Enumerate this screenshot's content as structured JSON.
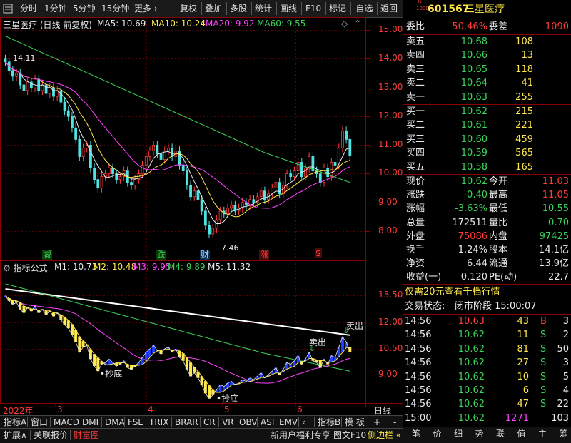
{
  "toolbar": {
    "left": [
      "分时",
      "1分钟",
      "5分钟",
      "15分钟",
      "更多 ›"
    ],
    "right": [
      "复权",
      "叠加",
      "多股",
      "统计",
      "画线",
      "F10",
      "标记",
      "-自选",
      "返回"
    ]
  },
  "chart": {
    "title": "三星医疗 (日线 前复权)",
    "ma": [
      {
        "label": "MA5: 10.69",
        "color": "#e8e8e8"
      },
      {
        "label": "MA10: 10.24",
        "color": "#ffe84a"
      },
      {
        "label": "MA20: 9.92",
        "color": "#ff44ff"
      },
      {
        "label": "MA60: 9.55",
        "color": "#3cd35a"
      }
    ],
    "price_axis": [
      "15.00",
      "14.00",
      "13.00",
      "12.00",
      "11.00",
      "10.00",
      "9.00",
      "8.00"
    ],
    "high_note": "14.11",
    "low_note": "7.46",
    "markers": [
      {
        "text": "减",
        "color": "#3cd35a"
      },
      {
        "text": "跌",
        "color": "#3cd35a"
      },
      {
        "text": "财",
        "color": "#4fa0ff"
      },
      {
        "text": "涨",
        "color": "#ff3b3b"
      },
      {
        "text": "$",
        "color": "#ff3b3b"
      }
    ],
    "indicator_title": "指标公式",
    "indicator_lines": [
      {
        "label": "M1: 10.73",
        "color": "#e8e8e8"
      },
      {
        "label": "M2: 10.48",
        "color": "#ffe84a"
      },
      {
        "label": "M3: 9.95",
        "color": "#ff44ff"
      },
      {
        "label": "M4: 9.89",
        "color": "#3cd35a"
      },
      {
        "label": "M5: 11.32",
        "color": "#e8e8e8"
      }
    ],
    "indicator_axis": [
      "13.50",
      "12.00",
      "10.50",
      "9.00"
    ],
    "annotations": {
      "buy1": "•抄底",
      "buy2": "•抄底",
      "sell1": "卖出",
      "sell2": "卖出"
    },
    "x_axis": [
      "2022年",
      "3",
      "4",
      "5",
      "6"
    ],
    "x_axis_right": "日线"
  },
  "tabs_row1": [
    "指标A",
    "窗口",
    "MACD",
    "DMI",
    "DMA",
    "FSL",
    "TRIX",
    "BRAR",
    "CR",
    "VR",
    "OBV",
    "ASI",
    "EMV",
    "‹",
    "指标B",
    "模 板",
    "+",
    "-"
  ],
  "tabs_row2": {
    "left": [
      "扩展∧",
      "关联报价",
      "财富圈"
    ],
    "right": [
      "新用户福利专享",
      "图文F10",
      "侧边栏 «"
    ]
  },
  "panel": {
    "code": "601567",
    "name": "三星医疗",
    "badge": "R",
    "wei_bi_label": "委比",
    "wei_bi": "50.46%",
    "wei_cha_label": "委差",
    "wei_cha": "1090",
    "asks": [
      {
        "label": "卖五",
        "price": "10.68",
        "vol": "108"
      },
      {
        "label": "卖四",
        "price": "10.66",
        "vol": "13"
      },
      {
        "label": "卖三",
        "price": "10.65",
        "vol": "118"
      },
      {
        "label": "卖二",
        "price": "10.64",
        "vol": "41"
      },
      {
        "label": "卖一",
        "price": "10.63",
        "vol": "255"
      }
    ],
    "bids": [
      {
        "label": "买一",
        "price": "10.62",
        "vol": "215"
      },
      {
        "label": "买二",
        "price": "10.61",
        "vol": "221"
      },
      {
        "label": "买三",
        "price": "10.60",
        "vol": "459"
      },
      {
        "label": "买四",
        "price": "10.59",
        "vol": "565"
      },
      {
        "label": "买五",
        "price": "10.58",
        "vol": "165"
      }
    ],
    "stats": [
      {
        "l1": "现价",
        "v1": "10.62",
        "c1": "green",
        "l2": "今开",
        "v2": "11.03",
        "c2": "red"
      },
      {
        "l1": "涨跌",
        "v1": "-0.40",
        "c1": "green",
        "l2": "最高",
        "v2": "11.05",
        "c2": "red"
      },
      {
        "l1": "涨幅",
        "v1": "-3.63%",
        "c1": "green",
        "l2": "最低",
        "v2": "10.55",
        "c2": "green"
      },
      {
        "l1": "总量",
        "v1": "172511",
        "c1": "white",
        "l2": "量比",
        "v2": "0.70",
        "c2": "green"
      },
      {
        "l1": "外盘",
        "v1": "75086",
        "c1": "red",
        "l2": "内盘",
        "v2": "97425",
        "c2": "green"
      }
    ],
    "stats2": [
      {
        "l1": "换手",
        "v1": "1.24%",
        "l2": "股本",
        "v2": "14.1亿"
      },
      {
        "l1": "净资",
        "v1": "6.44",
        "l2": "流通",
        "v2": "13.9亿"
      },
      {
        "l1": "收益(一)",
        "v1": "0.120",
        "l2": "PE(动)",
        "v2": "22.7"
      }
    ],
    "promo": "仅需20元查看千档行情",
    "trade_status_label": "交易状态:",
    "trade_status": "闭市阶段 15:00:07",
    "ticks": [
      {
        "time": "14:56",
        "price": "10.63",
        "pc": "red",
        "vol": "43",
        "side": "B",
        "sc": "red",
        "n": "3"
      },
      {
        "time": "14:56",
        "price": "10.62",
        "pc": "green",
        "vol": "11",
        "side": "S",
        "sc": "green",
        "n": "2"
      },
      {
        "time": "14:56",
        "price": "10.62",
        "pc": "green",
        "vol": "81",
        "side": "S",
        "sc": "green",
        "n": "50"
      },
      {
        "time": "14:56",
        "price": "10.62",
        "pc": "green",
        "vol": "27",
        "side": "S",
        "sc": "green",
        "n": "3"
      },
      {
        "time": "14:56",
        "price": "10.62",
        "pc": "green",
        "vol": "10",
        "side": "S",
        "sc": "green",
        "n": "5"
      },
      {
        "time": "14:56",
        "price": "10.62",
        "pc": "green",
        "vol": "6",
        "side": "S",
        "sc": "green",
        "n": "4"
      },
      {
        "time": "14:56",
        "price": "10.62",
        "pc": "green",
        "vol": "47",
        "side": "S",
        "sc": "green",
        "n": "22"
      },
      {
        "time": "15:00",
        "price": "10.62",
        "pc": "green",
        "vol": "1271",
        "side": "",
        "sc": "green",
        "n": "103"
      }
    ],
    "bottom_tabs": [
      "笔",
      "价",
      "细",
      "势",
      "联",
      "值",
      "主",
      "筹"
    ]
  }
}
